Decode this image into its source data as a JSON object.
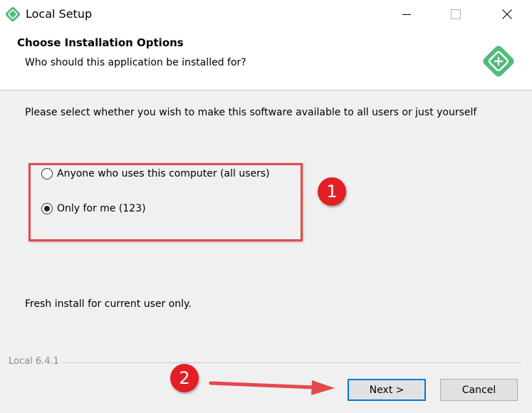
{
  "window": {
    "title": "Local Setup",
    "controls": [
      "minimize",
      "maximize",
      "close"
    ]
  },
  "header": {
    "title": "Choose Installation Options",
    "subtitle": "Who should this application be installed for?"
  },
  "body": {
    "intro": "Please select whether you wish to make this software available to all users or just yourself",
    "options": [
      {
        "label": "Anyone who uses this computer (all users)",
        "selected": false
      },
      {
        "label": "Only for me (123)",
        "selected": true
      }
    ],
    "status": "Fresh install for current user only."
  },
  "footer": {
    "brand": "Local 6.4.1",
    "next_label": "Next >",
    "cancel_label": "Cancel"
  },
  "annotations": {
    "badge1": "1",
    "badge2": "2",
    "color": "#e31e24"
  },
  "colors": {
    "brand_green": "#51bb7b",
    "focus_blue": "#0078d7"
  }
}
